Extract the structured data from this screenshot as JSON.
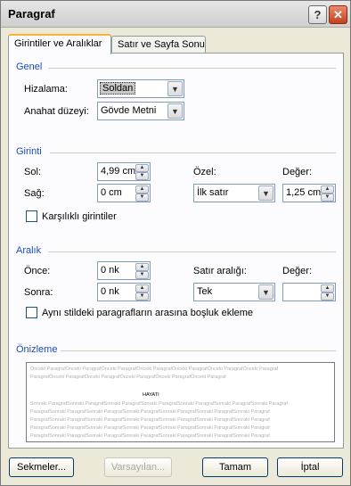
{
  "window": {
    "title": "Paragraf"
  },
  "titlebar": {
    "help_glyph": "?",
    "close_glyph": "✕"
  },
  "tabs": [
    {
      "label": "Girintiler ve Aralıklar",
      "active": true
    },
    {
      "label": "Satır ve Sayfa Sonu",
      "active": false
    }
  ],
  "genel": {
    "title": "Genel",
    "hizalama_label": "Hizalama:",
    "hizalama_value": "Soldan",
    "anahat_label": "Anahat düzeyi:",
    "anahat_value": "Gövde Metni"
  },
  "girinti": {
    "title": "Girinti",
    "sol_label": "Sol:",
    "sol_value": "4,99 cm",
    "sag_label": "Sağ:",
    "sag_value": "0 cm",
    "ozel_label": "Özel:",
    "ozel_value": "İlk satır",
    "deger_label": "Değer:",
    "deger_value": "1,25 cm",
    "karsilikli_label": "Karşılıklı girintiler",
    "karsilikli_checked": false
  },
  "aralik": {
    "title": "Aralık",
    "once_label": "Önce:",
    "once_value": "0 nk",
    "sonra_label": "Sonra:",
    "sonra_value": "0 nk",
    "satir_label": "Satır aralığı:",
    "satir_value": "Tek",
    "deger_label": "Değer:",
    "deger_value": "",
    "ayni_label": "Aynı stildeki paragrafların arasına boşluk ekleme",
    "ayni_checked": false
  },
  "onizleme": {
    "title": "Önizleme",
    "prev_lines": [
      "Önceki ParagrafÖnceki ParagrafÖnceki ParagrafÖnceki ParagrafÖnceki ParagrafÖnceki ParagrafÖnceki Paragraf",
      "ParagrafÖnceki ParagrafÖnceki ParagrafÖnceki ParagrafÖnceki ParagrafÖnceki Paragraf"
    ],
    "current": "HAYATI",
    "next_lines": [
      "Sonraki ParagrafSonraki ParagrafSonraki ParagrafSonraki ParagrafSonraki ParagrafSonraki ParagrafSonraki Paragraf",
      "ParagrafSonraki ParagrafSonraki ParagrafSonraki ParagrafSonraki ParagrafSonraki ParagrafSonraki Paragraf",
      "ParagrafSonraki ParagrafSonraki ParagrafSonraki ParagrafSonraki ParagrafSonraki ParagrafSonraki Paragraf",
      "ParagrafSonraki ParagrafSonraki ParagrafSonraki ParagrafSonraki ParagrafSonraki ParagrafSonraki Paragraf",
      "ParagrafSonraki ParagrafSonraki ParagrafSonraki ParagrafSonraki ParagrafSonraki ParagrafSonraki Paragraf"
    ]
  },
  "buttons": {
    "sekmeler": "Sekmeler...",
    "varsayilan": "Varsayılan...",
    "tamam": "Tamam",
    "iptal": "İptal"
  }
}
